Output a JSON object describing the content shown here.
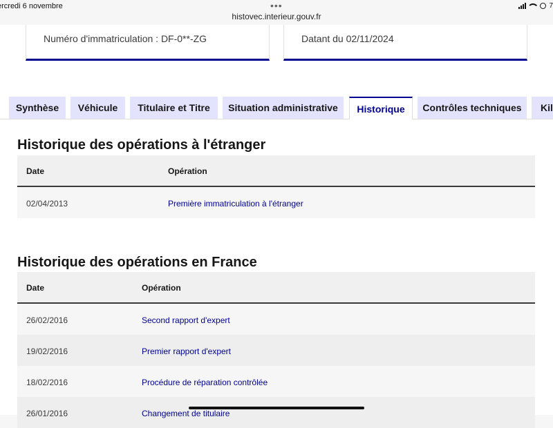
{
  "statusbar": {
    "date": "ercredi 6 novembre",
    "url": "histovec.interieur.gouv.fr",
    "battery": "7"
  },
  "cards": {
    "registration": "Numéro d'immatriculation : DF-0**-ZG",
    "dated": "Datant du 02/11/2024"
  },
  "tabs": [
    {
      "label": "Synthèse"
    },
    {
      "label": "Véhicule"
    },
    {
      "label": "Titulaire et Titre"
    },
    {
      "label": "Situation administrative"
    },
    {
      "label": "Historique"
    },
    {
      "label": "Contrôles techniques"
    },
    {
      "label": "Kil"
    }
  ],
  "active_tab": "Historique",
  "foreign": {
    "title": "Historique des opérations à l'étranger",
    "headers": [
      "Date",
      "Opération"
    ],
    "rows": [
      {
        "date": "02/04/2013",
        "operation": "Première immatriculation à l'étranger"
      }
    ]
  },
  "france": {
    "title": "Historique des opérations en France",
    "headers": [
      "Date",
      "Opération"
    ],
    "rows": [
      {
        "date": "26/02/2016",
        "operation": "Second rapport d'expert"
      },
      {
        "date": "19/02/2016",
        "operation": "Premier rapport d'expert"
      },
      {
        "date": "18/02/2016",
        "operation": "Procédure de réparation contrôlée"
      },
      {
        "date": "26/01/2016",
        "operation": "Changement de titulaire"
      }
    ]
  }
}
